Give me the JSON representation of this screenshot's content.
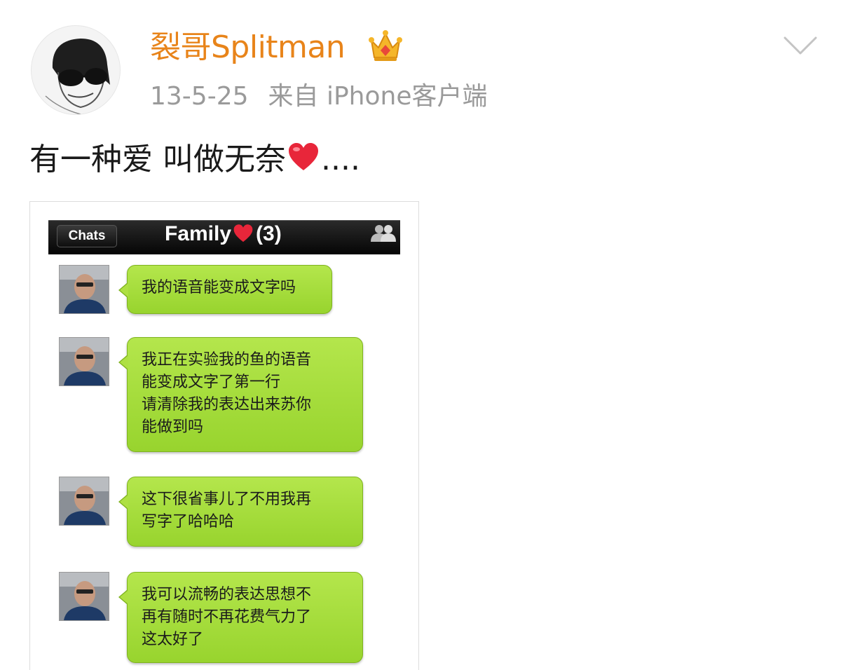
{
  "post": {
    "author": "裂哥Splitman",
    "author_color": "#e8841a",
    "date": "13-5-25",
    "source": "来自 iPhone客户端",
    "text_before": "有一种爱 叫做无奈",
    "text_after": "....",
    "icons": {
      "badge": "crown-icon",
      "options": "chevron-down-icon",
      "emoji": "heart-icon"
    }
  },
  "chat_screenshot": {
    "back_label": "Chats",
    "title": "Family",
    "member_count": "(3)",
    "icons": {
      "title_emoji": "heart-icon",
      "members": "people-icon"
    },
    "bubble_color": "#a8de3c",
    "messages": [
      {
        "lines": [
          "我的语音能变成文字吗"
        ]
      },
      {
        "lines": [
          "我正在实验我的鱼的语音",
          "能变成文字了第一行",
          "请清除我的表达出来苏你",
          "能做到吗"
        ]
      },
      {
        "lines": [
          "这下很省事儿了不用我再",
          "写字了哈哈哈"
        ]
      },
      {
        "lines": [
          "我可以流畅的表达思想不",
          "再有随时不再花费气力了",
          "这太好了"
        ]
      }
    ]
  }
}
